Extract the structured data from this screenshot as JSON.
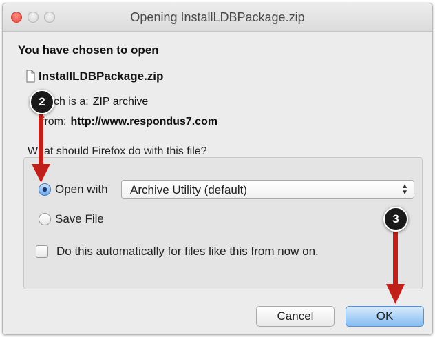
{
  "window": {
    "title": "Opening InstallLDBPackage.zip"
  },
  "dialog": {
    "heading": "You have chosen to open",
    "file_name": "InstallLDBPackage.zip",
    "which_is_label": "which is a:",
    "which_is_value": "ZIP archive",
    "from_label": "from:",
    "from_value": "http://www.respondus7.com",
    "question": "What should Firefox do with this file?"
  },
  "options": {
    "open_with_label": "Open with",
    "open_with_selected": true,
    "application": "Archive Utility (default)",
    "save_file_label": "Save File",
    "save_file_selected": false,
    "auto_label": "Do this automatically for files like this from now on.",
    "auto_checked": false
  },
  "buttons": {
    "cancel": "Cancel",
    "ok": "OK"
  },
  "annotations": {
    "step_2": "2",
    "step_3": "3",
    "arrow_color": "#c0201a"
  },
  "icons": [
    "close-icon",
    "minimize-icon",
    "zoom-icon",
    "document-icon",
    "select-arrows-icon"
  ]
}
